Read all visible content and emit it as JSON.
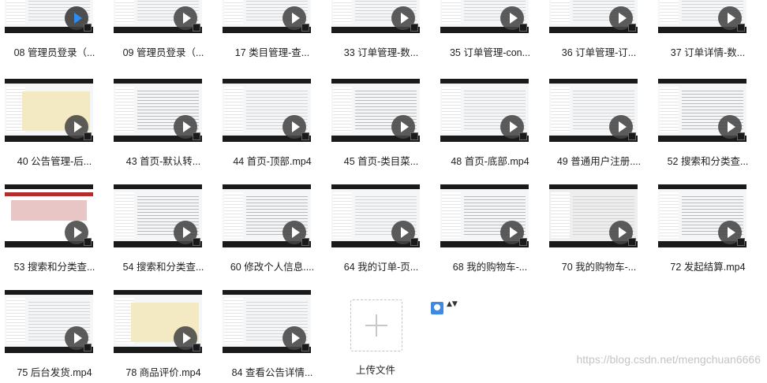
{
  "files": [
    {
      "label": "08 管理员登录（...",
      "thumb": "code",
      "playing": true
    },
    {
      "label": "09 管理员登录（...",
      "thumb": "code"
    },
    {
      "label": "17 类目管理-查...",
      "thumb": "code"
    },
    {
      "label": "33 订单管理-数...",
      "thumb": "code"
    },
    {
      "label": "35 订单管理-con...",
      "thumb": "code"
    },
    {
      "label": "36 订单管理-订...",
      "thumb": "code"
    },
    {
      "label": "37 订单详情-数...",
      "thumb": "code"
    },
    {
      "label": "40 公告管理-后...",
      "thumb": "yellow"
    },
    {
      "label": "43 首页-默认转...",
      "thumb": "green"
    },
    {
      "label": "44 首页-顶部.mp4",
      "thumb": "code"
    },
    {
      "label": "45 首页-类目菜...",
      "thumb": "green"
    },
    {
      "label": "48 首页-底部.mp4",
      "thumb": "code"
    },
    {
      "label": "49 普通用户注册....",
      "thumb": "code"
    },
    {
      "label": "52 搜索和分类查...",
      "thumb": "green"
    },
    {
      "label": "53 搜索和分类查...",
      "thumb": "web"
    },
    {
      "label": "54 搜索和分类查...",
      "thumb": "green"
    },
    {
      "label": "60 修改个人信息....",
      "thumb": "green"
    },
    {
      "label": "64 我的订单-页...",
      "thumb": "code"
    },
    {
      "label": "68 我的购物车-...",
      "thumb": "green"
    },
    {
      "label": "70 我的购物车-...",
      "thumb": "dark"
    },
    {
      "label": "72 发起结算.mp4",
      "thumb": "green"
    },
    {
      "label": "75 后台发货.mp4",
      "thumb": "code"
    },
    {
      "label": "78 商品评价.mp4",
      "thumb": "yellow"
    },
    {
      "label": "84 查看公告详情...",
      "thumb": "code"
    }
  ],
  "upload": {
    "label": "上传文件"
  },
  "view_switch": {
    "icon": "user-icon",
    "arrows": "▲▼"
  },
  "watermark": "https://blog.csdn.net/mengchuan6666",
  "colors": {
    "accent": "#2d8cf0",
    "thumb_bg": "#1a1a1a",
    "label": "#222222"
  }
}
